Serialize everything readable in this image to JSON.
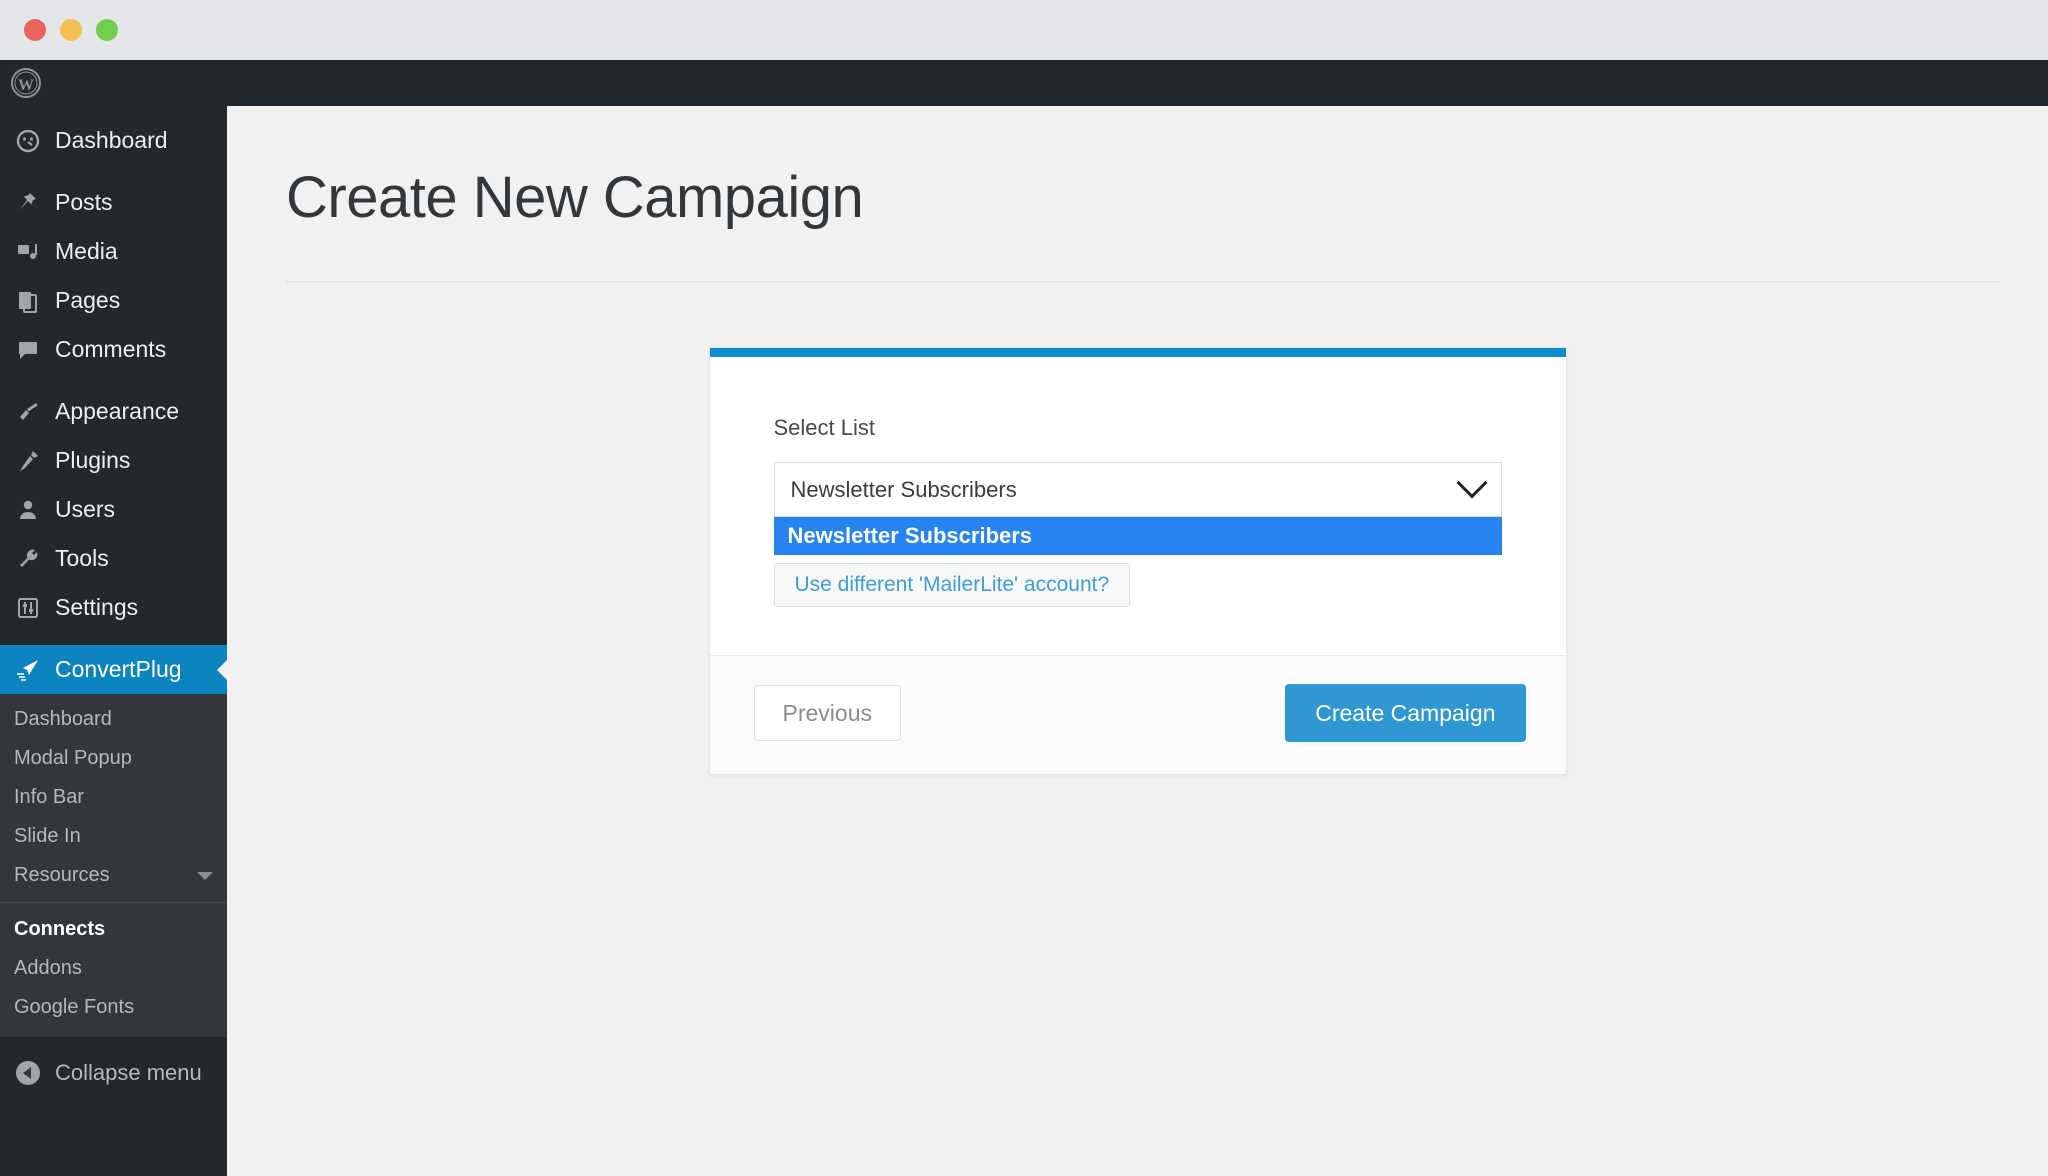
{
  "window": {
    "traffic_lights": [
      "close",
      "minimize",
      "zoom"
    ]
  },
  "adminbar": {
    "logo": "wordpress-logo"
  },
  "sidebar": {
    "items": [
      {
        "label": "Dashboard",
        "icon": "dashboard-icon",
        "active": false
      },
      {
        "label": "Posts",
        "icon": "pin-icon",
        "active": false
      },
      {
        "label": "Media",
        "icon": "media-icon",
        "active": false
      },
      {
        "label": "Pages",
        "icon": "pages-icon",
        "active": false
      },
      {
        "label": "Comments",
        "icon": "comment-icon",
        "active": false
      },
      {
        "label": "Appearance",
        "icon": "brush-icon",
        "active": false
      },
      {
        "label": "Plugins",
        "icon": "plugin-icon",
        "active": false
      },
      {
        "label": "Users",
        "icon": "user-icon",
        "active": false
      },
      {
        "label": "Tools",
        "icon": "wrench-icon",
        "active": false
      },
      {
        "label": "Settings",
        "icon": "sliders-icon",
        "active": false
      },
      {
        "label": "ConvertPlug",
        "icon": "convertplug-icon",
        "active": true
      }
    ],
    "submenu": [
      {
        "label": "Dashboard",
        "current": false,
        "caret": false
      },
      {
        "label": "Modal Popup",
        "current": false,
        "caret": false
      },
      {
        "label": "Info Bar",
        "current": false,
        "caret": false
      },
      {
        "label": "Slide In",
        "current": false,
        "caret": false
      },
      {
        "label": "Resources",
        "current": false,
        "caret": true
      },
      {
        "label": "Connects",
        "current": true,
        "caret": false
      },
      {
        "label": "Addons",
        "current": false,
        "caret": false
      },
      {
        "label": "Google Fonts",
        "current": false,
        "caret": false
      }
    ],
    "collapse_label": "Collapse menu",
    "collapse_icon": "collapse-arrow-icon",
    "active_color": "#0c84c0"
  },
  "page": {
    "title": "Create New Campaign"
  },
  "card": {
    "accent_color": "#0d8ed0",
    "field_label": "Select List",
    "select": {
      "value": "Newsletter Subscribers",
      "chevron_icon": "chevron-down-icon",
      "options": [
        {
          "label": "Newsletter Subscribers",
          "selected": true
        }
      ],
      "highlight_color": "#2684f0"
    },
    "alt_account_label": "Use different 'MailerLite' account?",
    "footer": {
      "previous_label": "Previous",
      "create_label": "Create Campaign",
      "create_color": "#2f97d1"
    }
  }
}
